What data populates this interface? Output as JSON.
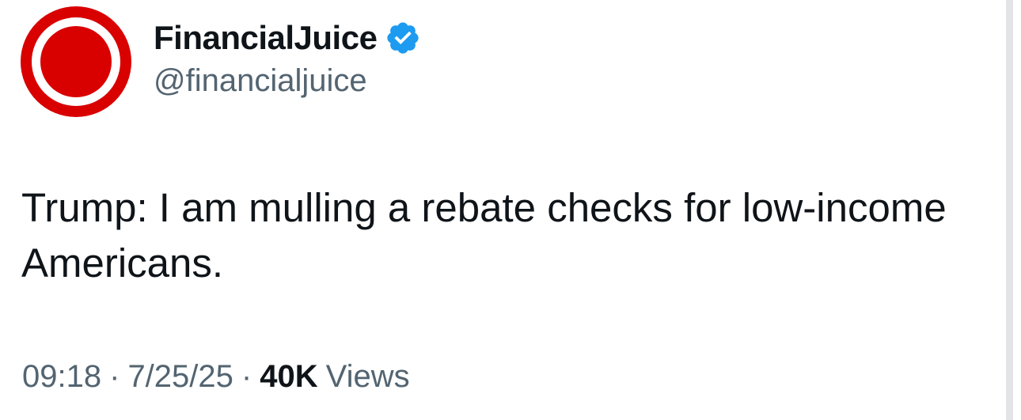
{
  "account": {
    "display_name": "FinancialJuice",
    "handle": "@financialjuice",
    "avatar_icon": "red-circle-ring-logo",
    "verified_icon": "verified-badge-icon",
    "brand_color": "#d90000",
    "verified_color": "#1d9bf0"
  },
  "tweet": {
    "text": "Trump: I am mulling a rebate checks for low-income Americans."
  },
  "meta": {
    "time": "09:18",
    "separator": "·",
    "date": "7/25/25",
    "views_count": "40K",
    "views_label": "Views"
  }
}
